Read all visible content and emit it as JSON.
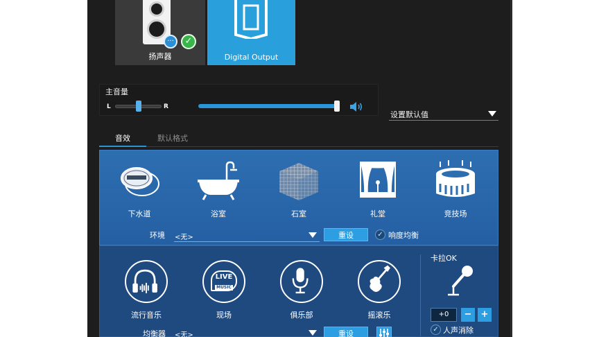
{
  "devices": {
    "speaker_label": "扬声器",
    "digital_label": "Digital Output"
  },
  "volume": {
    "title": "主音量",
    "left": "L",
    "right": "R",
    "balance": 0.5,
    "level": 1.0
  },
  "preset": {
    "value": "设置默认值"
  },
  "tabs": [
    {
      "label": "音效"
    },
    {
      "label": "默认格式"
    }
  ],
  "environment": {
    "items": [
      {
        "label": "下水道",
        "icon": "sewer-pipe-icon"
      },
      {
        "label": "浴室",
        "icon": "bathtub-icon"
      },
      {
        "label": "石室",
        "icon": "stone-room-icon"
      },
      {
        "label": "礼堂",
        "icon": "auditorium-icon"
      },
      {
        "label": "竞技场",
        "icon": "stadium-icon"
      }
    ],
    "row_label": "环境",
    "selected": "<无>",
    "reset_label": "重设",
    "loudness_label": "响度均衡"
  },
  "music": {
    "items": [
      {
        "label": "流行音乐",
        "icon": "headphones-icon"
      },
      {
        "label": "现场",
        "icon": "live-music-icon"
      },
      {
        "label": "俱乐部",
        "icon": "microphone-icon"
      },
      {
        "label": "摇滚乐",
        "icon": "electric-guitar-icon"
      }
    ],
    "live_badge_top": "LIVE",
    "live_badge_bottom": "MUSIC",
    "eq_label": "均衡器",
    "eq_selected": "<无>",
    "reset_label": "重设"
  },
  "karaoke": {
    "title": "卡拉OK",
    "key_value": "+0",
    "minus": "−",
    "plus": "+",
    "vocal_cancel_label": "人声消除"
  },
  "colors": {
    "accent": "#2b94d8",
    "panel_blue": "#2d6eb1",
    "panel_dark_blue": "#1f4a80",
    "background": "#1d1d1d"
  }
}
